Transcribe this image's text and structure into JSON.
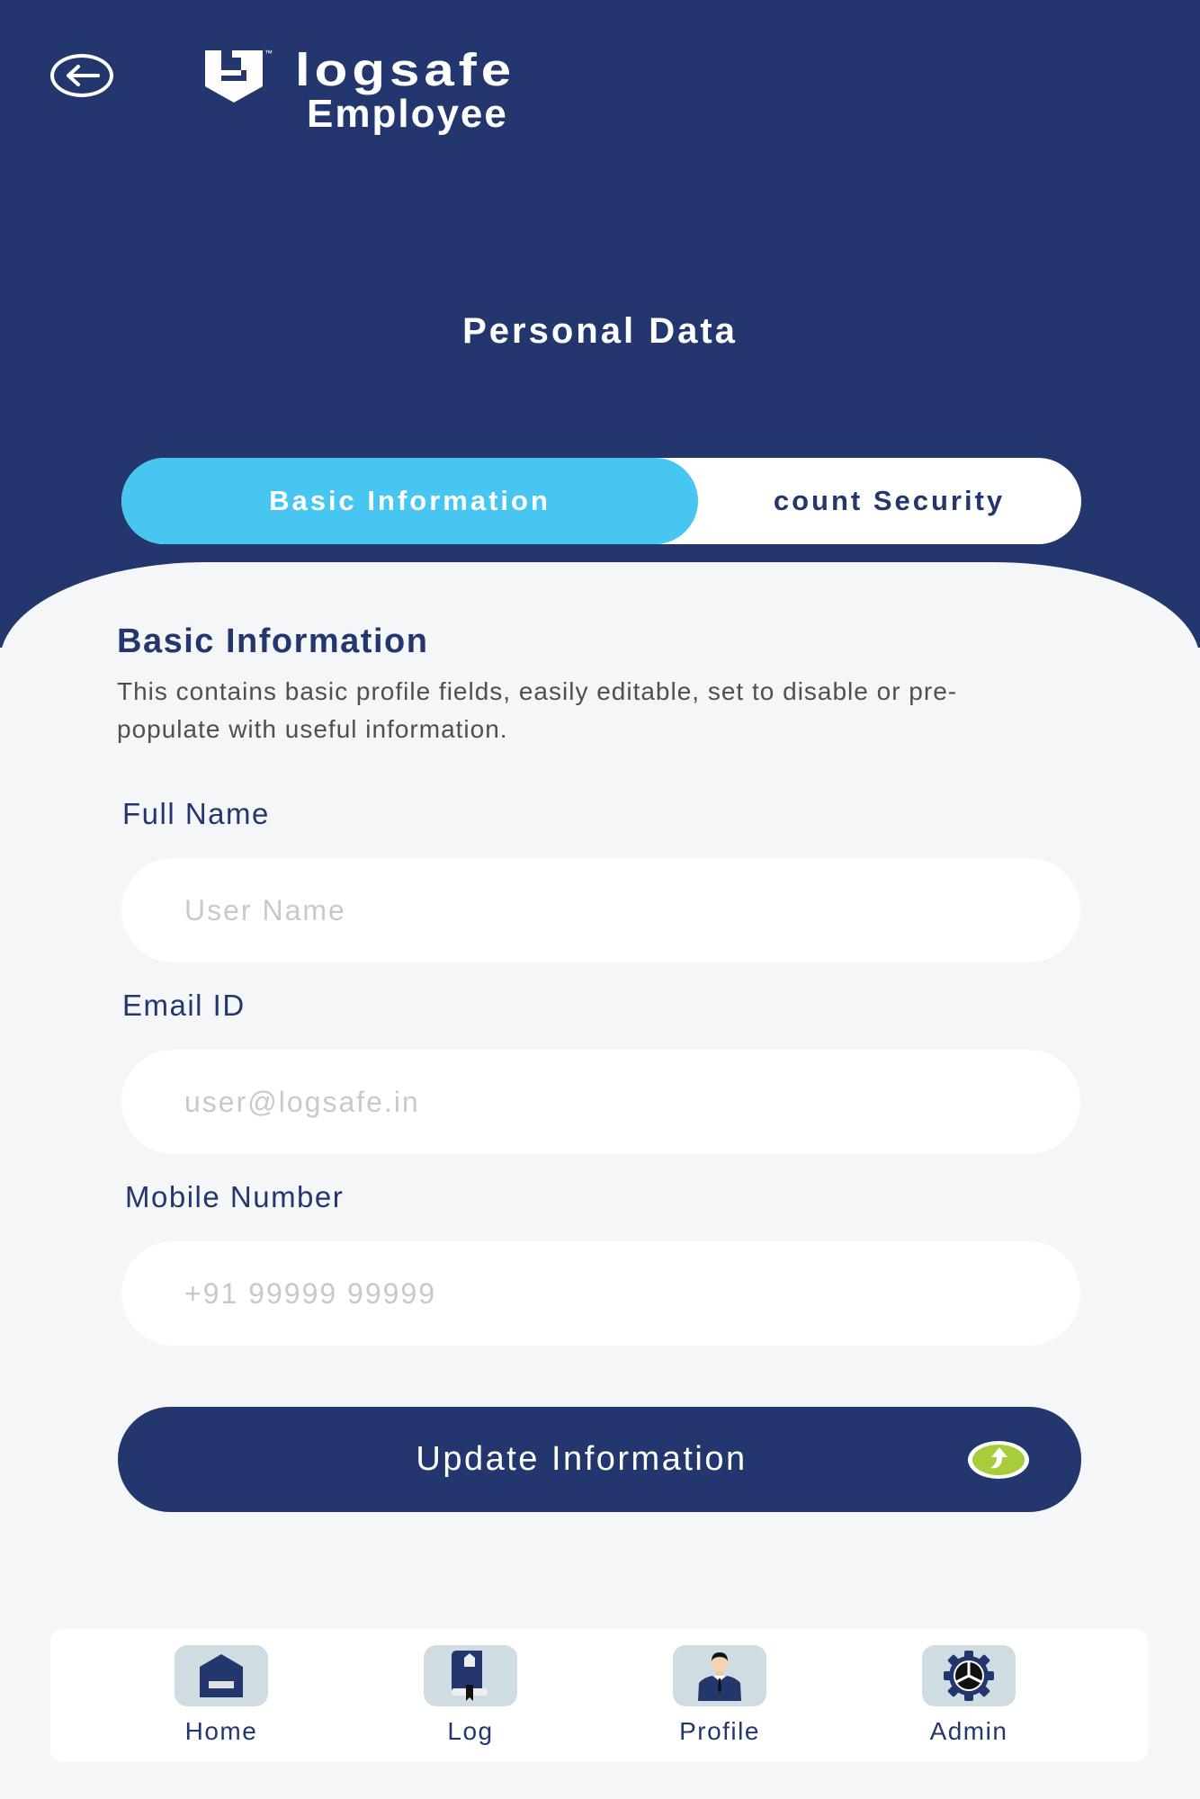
{
  "header": {
    "back_label": "Back",
    "brand_name": "logsafe",
    "brand_tm": "™",
    "brand_subtitle": "Employee",
    "page_title": "Personal Data"
  },
  "tabs": [
    {
      "label": "Basic Information",
      "active": true
    },
    {
      "label": "Account Security",
      "visible_label": "count Security",
      "active": false
    }
  ],
  "section": {
    "title": "Basic Information",
    "description": "This contains basic profile fields, easily editable, set to disable or pre-populate with useful information."
  },
  "fields": [
    {
      "label": "Full Name",
      "value": "",
      "placeholder": "User Name"
    },
    {
      "label": "Email ID",
      "value": "",
      "placeholder": "user@logsafe.in"
    },
    {
      "label": "Mobile Number",
      "value": "",
      "placeholder": "+91 99999 99999"
    }
  ],
  "update_button": {
    "label": "Update Information",
    "icon": "upload-arrow-icon"
  },
  "bottom_nav": [
    {
      "label": "Home",
      "icon": "home-icon"
    },
    {
      "label": "Log",
      "icon": "log-book-icon"
    },
    {
      "label": "Profile",
      "icon": "profile-person-icon"
    },
    {
      "label": "Admin",
      "icon": "admin-gear-icon"
    }
  ],
  "colors": {
    "primary": "#23376e",
    "accent": "#47c6f2",
    "background": "#f5f6f7",
    "icon_tile": "#cfdde3",
    "upload_green": "#a8cc3a"
  }
}
